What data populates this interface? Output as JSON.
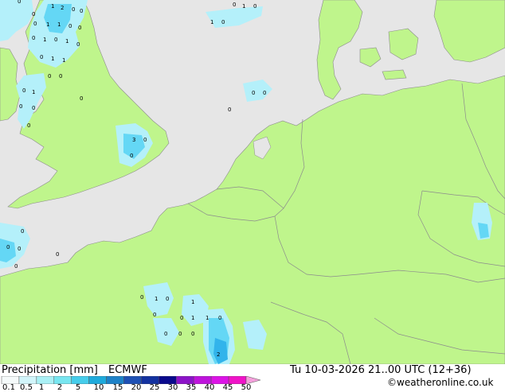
{
  "title": "Precipitation [mm]",
  "model": "ECMWF",
  "valid_time": "Tu 10-03-2026 21..00 UTC (12+36)",
  "credit": "©weatheronline.co.uk",
  "colors": {
    "sea": "#e6e6e6",
    "land": "#bff58c",
    "border": "#8c8c8c",
    "precip_light": "#b4f0fa",
    "precip_mid": "#64d7f5",
    "precip_heavy": "#32b4eb"
  },
  "legend": {
    "ticks": [
      "0.1",
      "0.5",
      "1",
      "2",
      "5",
      "10",
      "15",
      "20",
      "25",
      "30",
      "35",
      "40",
      "45",
      "50"
    ],
    "colors": [
      "#f5fafa",
      "#d2f5fa",
      "#aaf0f5",
      "#78e6f0",
      "#46cdeb",
      "#1eaadc",
      "#1e82c8",
      "#1e50b4",
      "#1432a0",
      "#0a0a8c",
      "#8c14c8",
      "#be14dc",
      "#dc14e6",
      "#f014c8",
      "#f5a0dc"
    ]
  },
  "map_labels": [
    "1",
    "2",
    "0",
    "0",
    "0",
    "0",
    "0",
    "1",
    "1",
    "0",
    "0",
    "1",
    "0",
    "1",
    "0",
    "0",
    "1",
    "1",
    "0",
    "0",
    "0",
    "1",
    "0",
    "0",
    "0",
    "0",
    "0",
    "3",
    "0",
    "0",
    "0",
    "1",
    "0",
    "1",
    "0",
    "0",
    "0",
    "0",
    "0",
    "0",
    "0",
    "0",
    "0",
    "0",
    "1",
    "0",
    "1",
    "0",
    "0",
    "1",
    "1",
    "2",
    "0",
    "0",
    "0",
    "0"
  ]
}
